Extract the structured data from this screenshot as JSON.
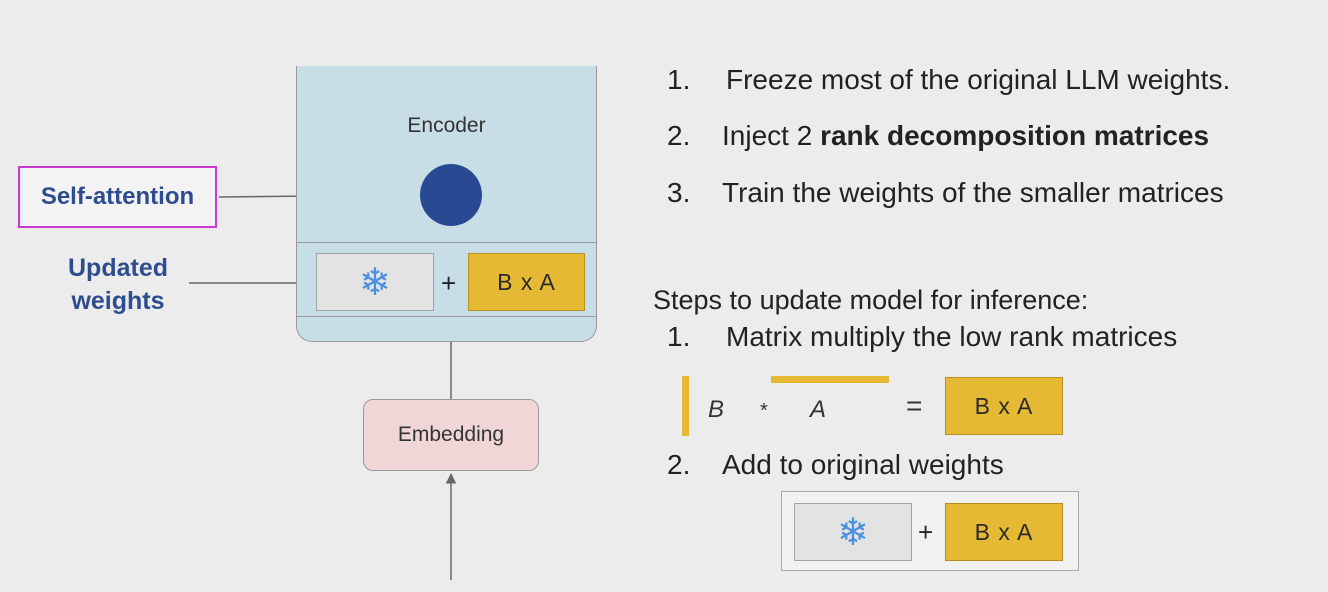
{
  "diagram": {
    "encoder_label": "Encoder",
    "self_attention_label": "Self-attention",
    "updated_weights_label_line1": "Updated",
    "updated_weights_label_line2": "weights",
    "embedding_label": "Embedding",
    "frozen_icon": "❄",
    "plus": "+",
    "ba_label": "B x A"
  },
  "steps": [
    {
      "num": "1.",
      "text": "Freeze most of the original LLM weights."
    },
    {
      "num": "2.",
      "text_plain": "Inject 2 ",
      "text_bold": "rank decomposition matrices"
    },
    {
      "num": "3.",
      "text": "Train the weights of the smaller matrices"
    }
  ],
  "inference": {
    "heading": "Steps to update model for inference:",
    "step1_num": "1.",
    "step1_text": "Matrix multiply the low rank matrices",
    "formula_b": "B",
    "formula_times": "*",
    "formula_a": "A",
    "formula_equals": "=",
    "formula_result": "B x A",
    "step2_num": "2.",
    "step2_text": "Add to original weights",
    "sum_icon": "❄",
    "sum_plus": "+",
    "sum_ba": "B x A"
  },
  "colors": {
    "encoder_fill": "#c8dee7",
    "attention_dot": "#294a93",
    "highlight_border": "#c93bd1",
    "label_blue": "#2e4d8f",
    "matrix_gold": "#e5b934",
    "embedding_fill": "#f1d6d8",
    "snowflake": "#4a8fe0"
  },
  "icons": [
    "snowflake-icon"
  ]
}
